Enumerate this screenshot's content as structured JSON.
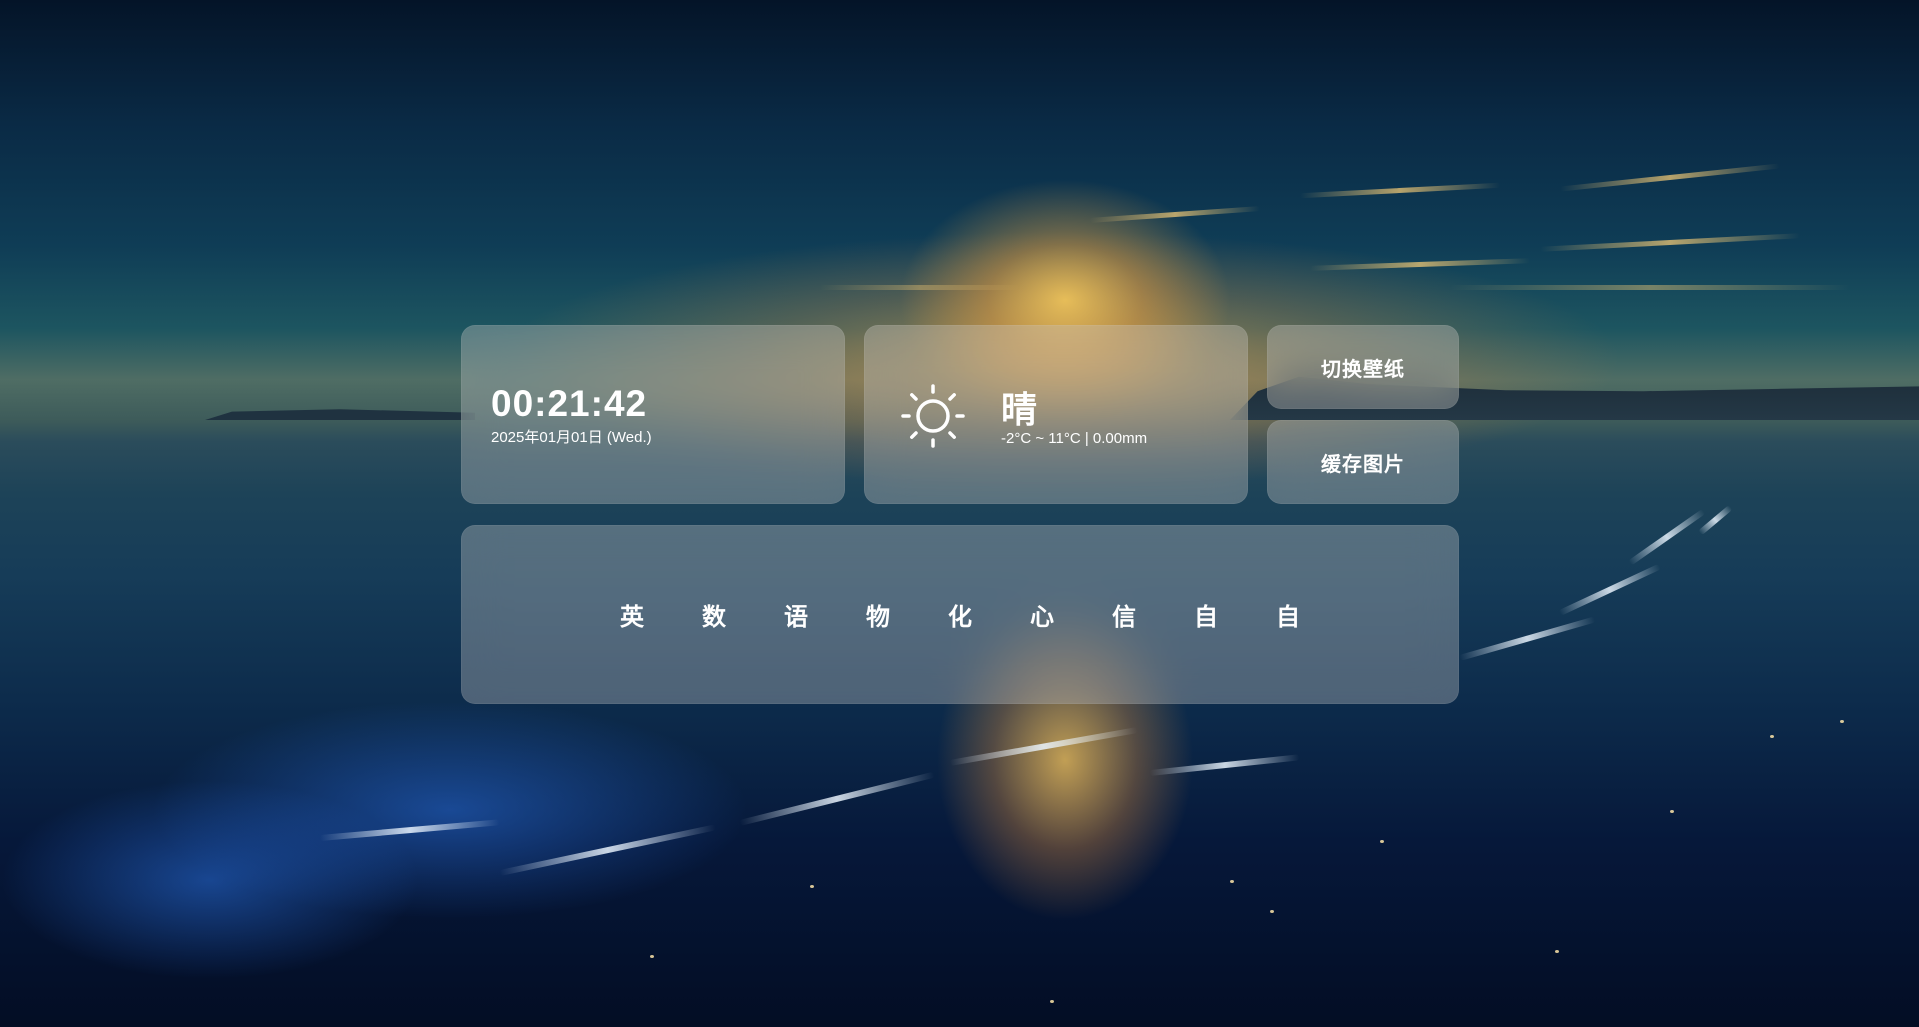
{
  "clock": {
    "time": "00:21:42",
    "date": "2025年01月01日 (Wed.)"
  },
  "weather": {
    "icon": "sun-icon",
    "description": "晴",
    "range": "-2°C ~ 11°C | 0.00mm"
  },
  "buttons": {
    "switch_wallpaper": "切换壁纸",
    "cache_image": "缓存图片"
  },
  "subjects": [
    "英",
    "数",
    "语",
    "物",
    "化",
    "心",
    "信",
    "自",
    "自"
  ],
  "colors": {
    "card_bg": "#c8c8c859",
    "text": "#ffffff"
  }
}
